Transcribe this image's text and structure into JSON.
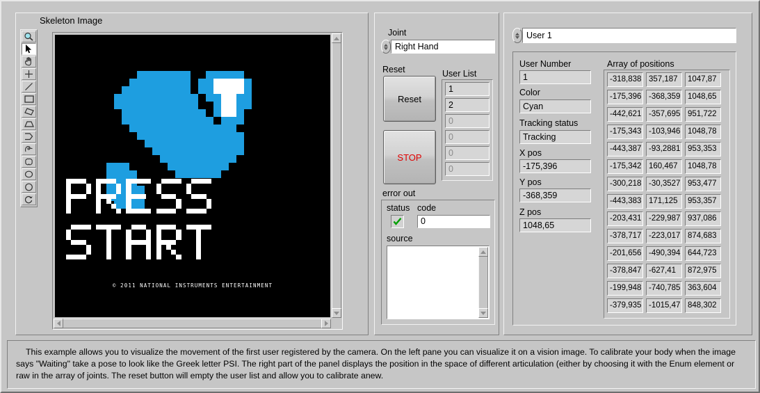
{
  "image_panel": {
    "title": "Skeleton Image",
    "copyright": "© 2011 NATIONAL INSTRUMENTS ENTERTAINMENT",
    "press_text_line1": "PRESS",
    "press_text_line2": "START",
    "tools": [
      {
        "name": "zoom-tool"
      },
      {
        "name": "selection-arrow-tool"
      },
      {
        "name": "pan-hand-tool"
      },
      {
        "name": "point-tool"
      },
      {
        "name": "line-tool"
      },
      {
        "name": "rectangle-tool"
      },
      {
        "name": "rotated-rectangle-tool"
      },
      {
        "name": "polygon-tool"
      },
      {
        "name": "broken-line-tool"
      },
      {
        "name": "freehand-tool"
      },
      {
        "name": "annulus-tool"
      },
      {
        "name": "oval-tool"
      },
      {
        "name": "circle-tool"
      },
      {
        "name": "rotate-tool"
      }
    ]
  },
  "controls": {
    "joint_label": "Joint",
    "joint_value": "Right Hand",
    "reset_label": "Reset",
    "reset_button": "Reset",
    "stop_button": "STOP",
    "user_list_label": "User List",
    "user_list": [
      "1",
      "2",
      "0",
      "0",
      "0",
      "0"
    ],
    "user_list_active_count": 2,
    "error_out_label": "error out",
    "status_label": "status",
    "status_icon": "check-mark",
    "code_label": "code",
    "code_value": "0",
    "source_label": "source",
    "source_value": ""
  },
  "user_panel": {
    "user_select_value": "User 1",
    "user_number_label": "User Number",
    "user_number_value": "1",
    "color_label": "Color",
    "color_value": "Cyan",
    "tracking_label": "Tracking status",
    "tracking_value": "Tracking",
    "x_label": "X pos",
    "x_value": "-175,396",
    "y_label": "Y pos",
    "y_value": "-368,359",
    "z_label": "Z pos",
    "z_value": "1048,65",
    "array_label": "Array of positions",
    "array_rows": [
      [
        "-318,838",
        "357,187",
        "1047,87"
      ],
      [
        "-175,396",
        "-368,359",
        "1048,65"
      ],
      [
        "-442,621",
        "-357,695",
        "951,722"
      ],
      [
        "-175,343",
        "-103,946",
        "1048,78"
      ],
      [
        "-443,387",
        "-93,2881",
        "953,353"
      ],
      [
        "-175,342",
        "160,467",
        "1048,78"
      ],
      [
        "-300,218",
        "-30,3527",
        "953,477"
      ],
      [
        "-443,383",
        "171,125",
        "953,357"
      ],
      [
        "-203,431",
        "-229,987",
        "937,086"
      ],
      [
        "-378,717",
        "-223,017",
        "874,683"
      ],
      [
        "-201,656",
        "-490,394",
        "644,723"
      ],
      [
        "-378,847",
        "-627,41",
        "872,975"
      ],
      [
        "-199,948",
        "-740,785",
        "363,604"
      ],
      [
        "-379,935",
        "-1015,47",
        "848,302"
      ]
    ]
  },
  "description": "This example allows you to visualize the movement of the first user registered by the camera. On the left pane you can visualize it on a vision image. To calibrate your body when the image says \"Waiting\" take a pose to look like the Greek letter PSI. The right part  of the panel displays the position in the space of different articulation (either by  choosing  it with the Enum element or raw in the array of joints. The reset button will  empty the user  list and allow you to calibrate anew.",
  "colors": {
    "panel": "#c6c6c6",
    "indicator": "#d6d6d6",
    "stop_red": "#e00000",
    "sprite_blue": "#1e9ee0",
    "status_green": "#00a000"
  }
}
